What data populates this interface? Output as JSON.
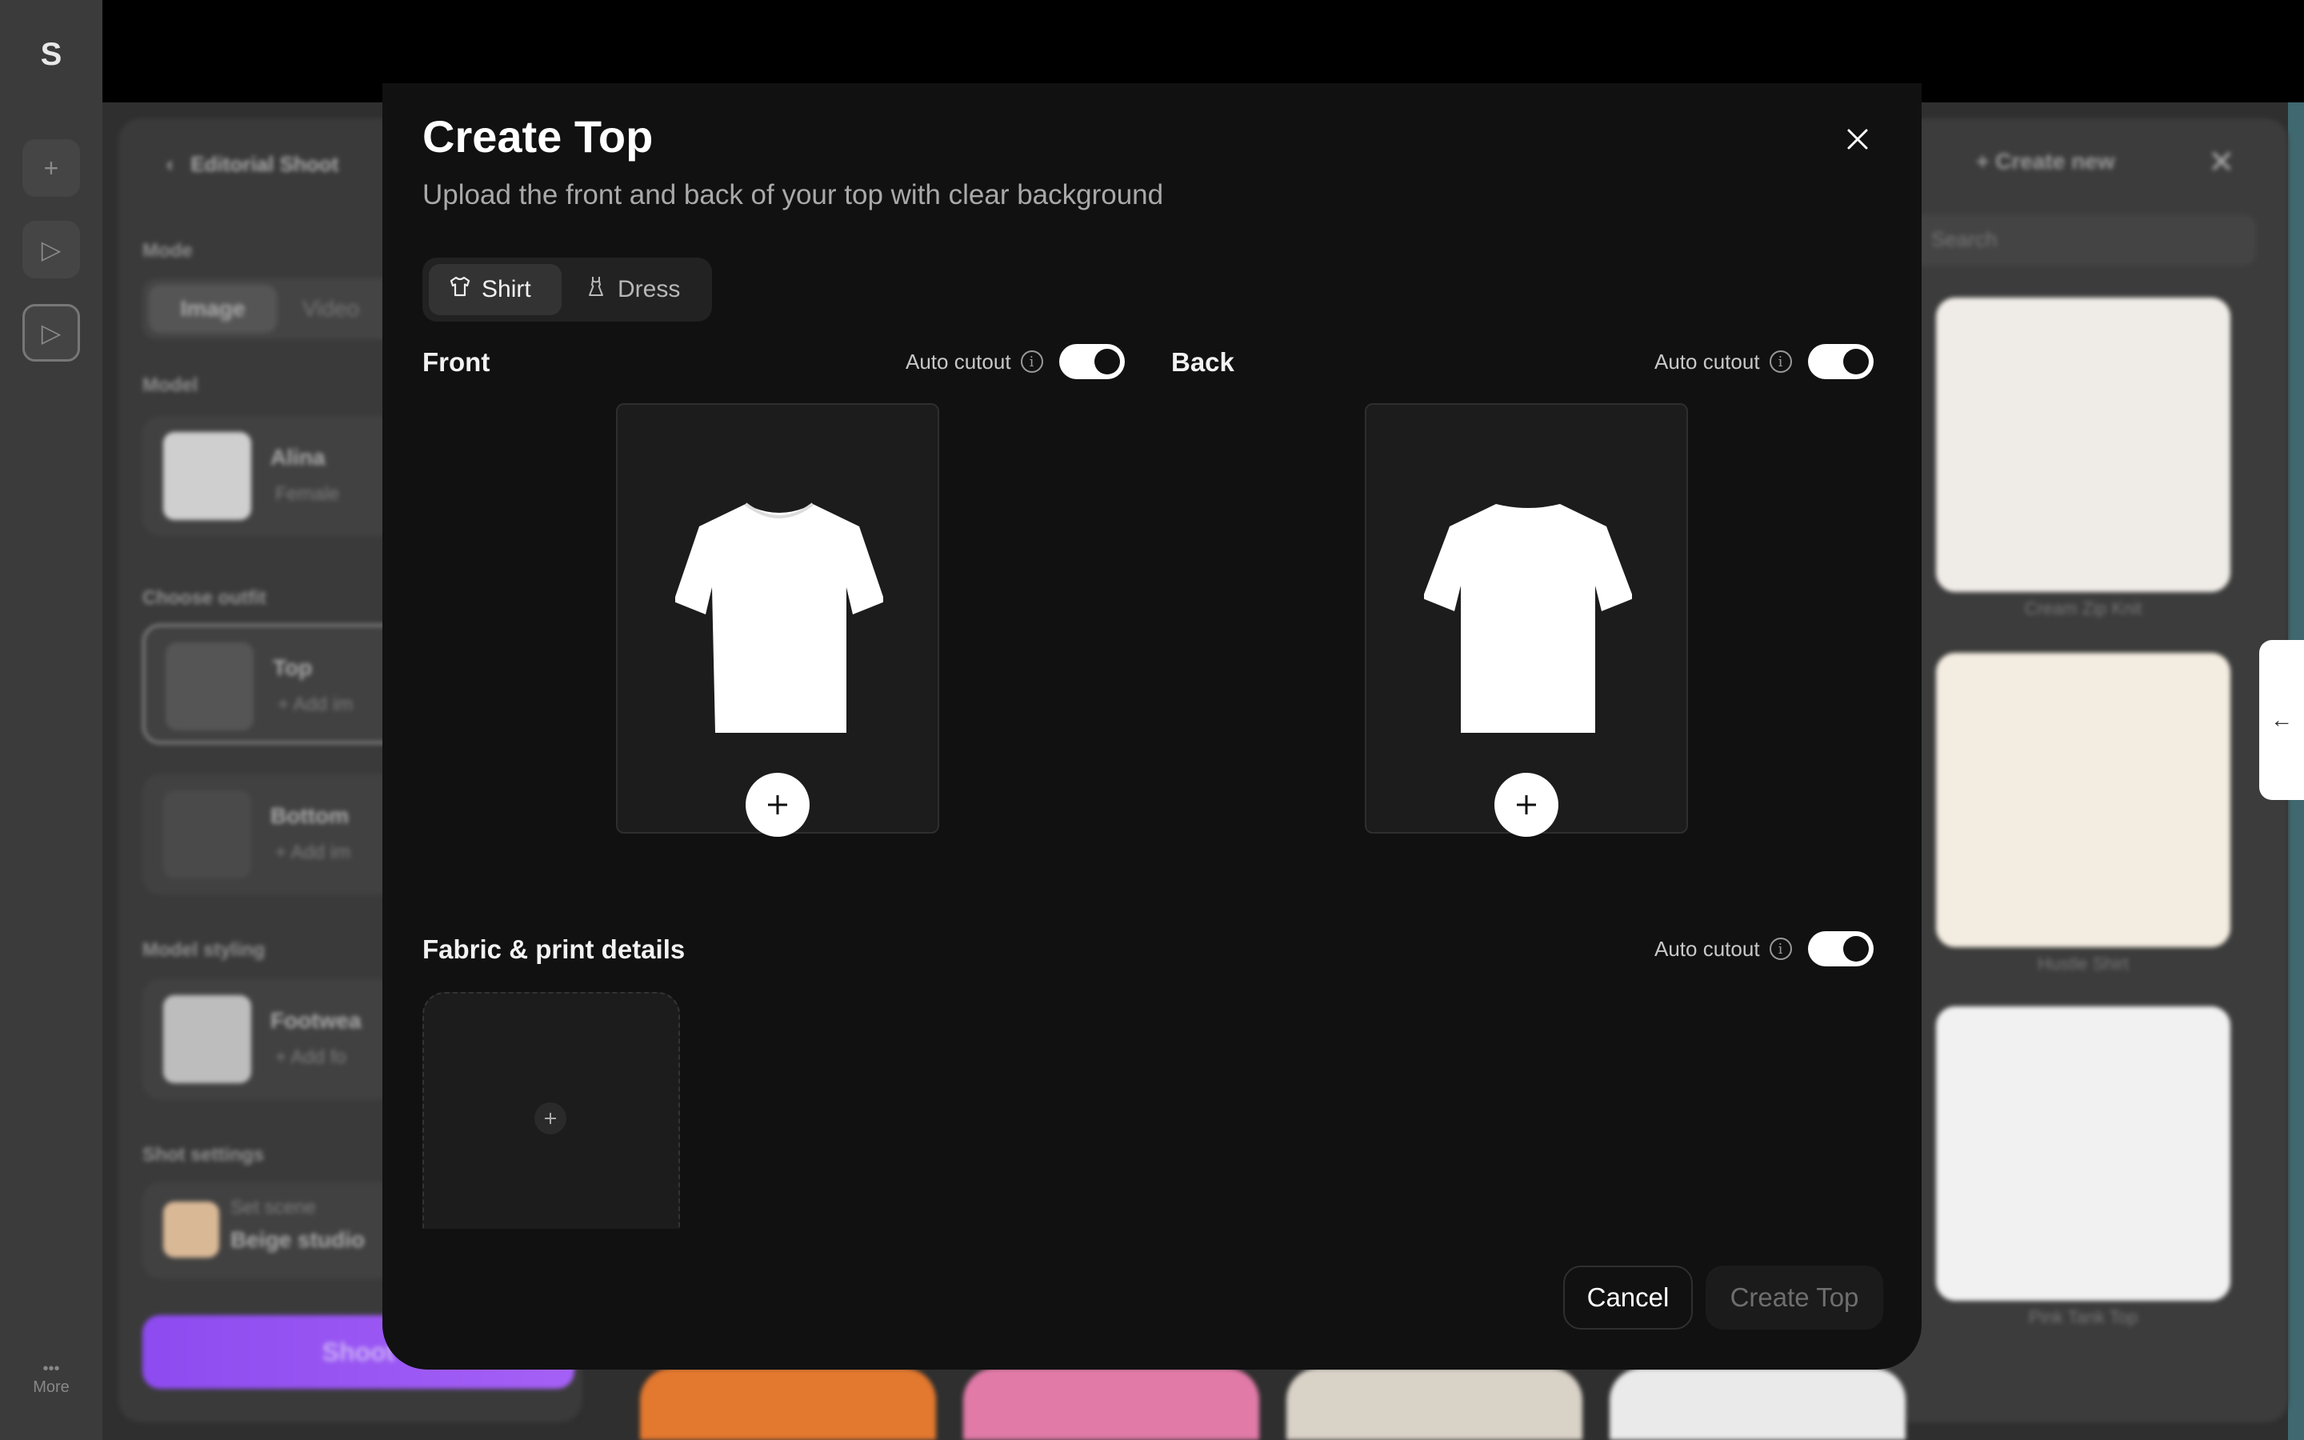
{
  "background": {
    "rail": {
      "logo_icon": "brand-logo-icon",
      "more_label": "More"
    },
    "left_panel": {
      "breadcrumb": "Editorial Shoot",
      "mode_label": "Mode",
      "mode_options": [
        "Image",
        "Video"
      ],
      "model_label": "Model",
      "model_name": "Alina",
      "model_gender": "Female",
      "outfit_label": "Choose outfit",
      "top_title": "Top",
      "top_add": "+ Add im",
      "bottom_title": "Bottom",
      "bottom_add": "+ Add im",
      "styling_label": "Model styling",
      "footwear_title": "Footwea",
      "footwear_add": "+ Add fo",
      "shot_label": "Shot settings",
      "scene_hint": "Set scene",
      "scene_value": "Beige studio",
      "shoot_button": "Shoot"
    },
    "right_panel": {
      "create_new": "+ Create new",
      "search_placeholder": "Search",
      "items": [
        {
          "caption": "Cream Zip Knit",
          "color": "#efebe6"
        },
        {
          "caption": "Hustle Shirt",
          "color": "#f3ece0"
        },
        {
          "caption": "Pink Tank Top",
          "color": "#f1f1f1"
        }
      ]
    }
  },
  "modal": {
    "title": "Create Top",
    "subtitle": "Upload the front and back of your top with clear background",
    "close_icon": "close-icon",
    "type_tabs": [
      {
        "label": "Shirt",
        "icon": "shirt-icon",
        "active": true
      },
      {
        "label": "Dress",
        "icon": "dress-icon",
        "active": false
      }
    ],
    "front": {
      "title": "Front",
      "auto_cutout_label": "Auto cutout",
      "auto_cutout_on": true
    },
    "back": {
      "title": "Back",
      "auto_cutout_label": "Auto cutout",
      "auto_cutout_on": true
    },
    "fabric": {
      "title": "Fabric & print details",
      "auto_cutout_label": "Auto cutout",
      "auto_cutout_on": true
    },
    "buttons": {
      "cancel": "Cancel",
      "create": "Create Top"
    }
  },
  "colors": {
    "modal_bg": "#111111",
    "accent_purple": "#9a55f3",
    "text_primary": "#ffffff",
    "text_secondary": "#a9a9a9"
  }
}
